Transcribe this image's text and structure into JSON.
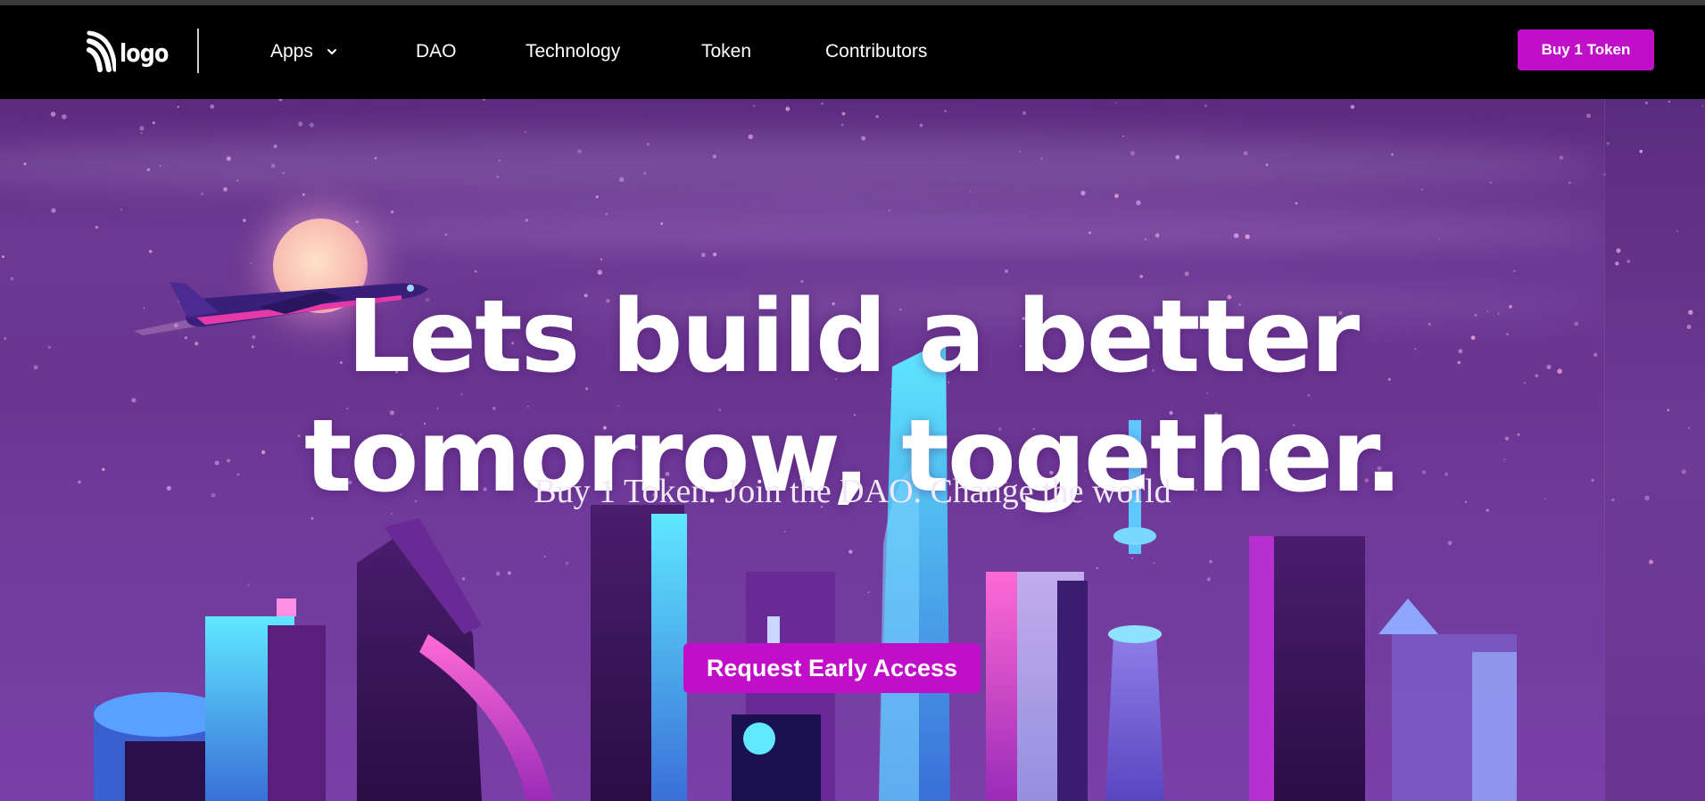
{
  "header": {
    "logo_text": "logo",
    "nav": [
      {
        "label": "Apps",
        "has_dropdown": true
      },
      {
        "label": "DAO"
      },
      {
        "label": "Technology"
      },
      {
        "label": "Token"
      },
      {
        "label": "Contributors"
      }
    ],
    "buy_button": "Buy 1 Token"
  },
  "hero": {
    "headline_line1": "Lets build a better",
    "headline_line2": "tomorrow, together.",
    "subheadline": "Buy 1 Token. Join the DAO. Change the world",
    "cta": "Request Early Access"
  },
  "colors": {
    "accent": "#c10fc9",
    "nav_bg": "#000000",
    "hero_bg": "#6a3590"
  },
  "icons": [
    "logo-waves-icon",
    "chevron-down-icon"
  ]
}
